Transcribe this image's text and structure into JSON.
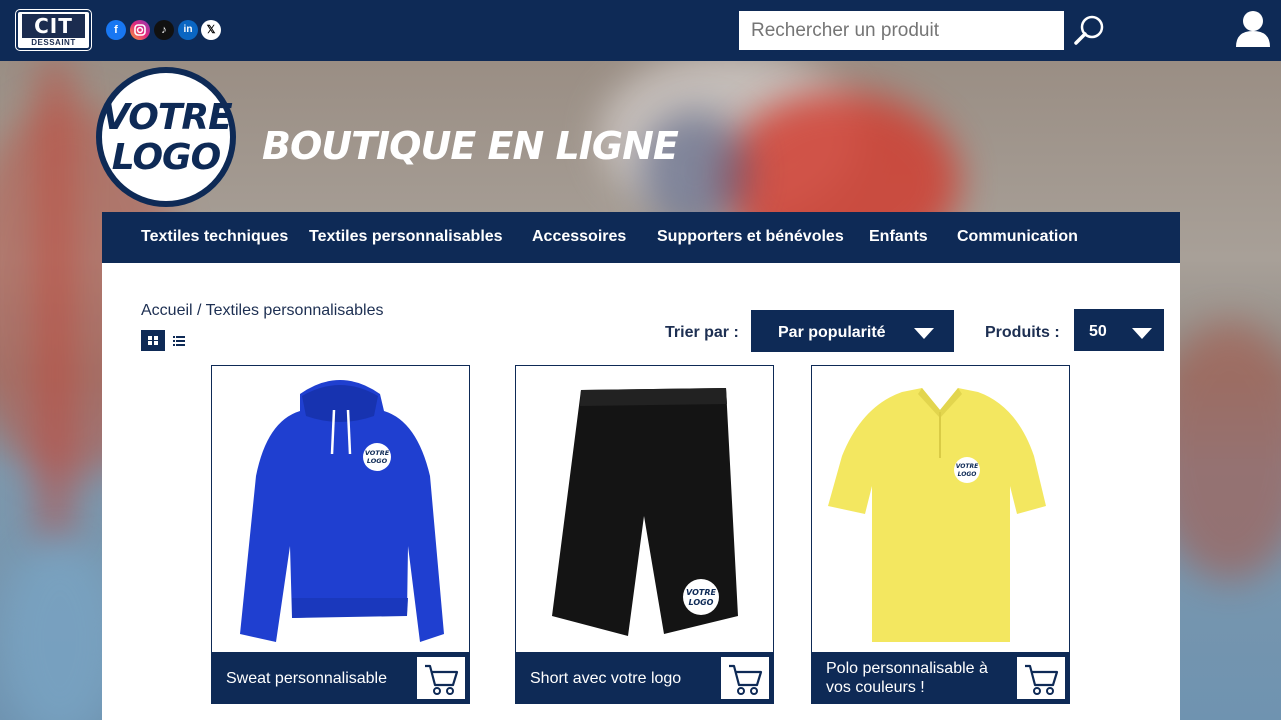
{
  "header": {
    "brand": {
      "mark": "CIT",
      "sub": "DESSAINT"
    },
    "social_icons": [
      "facebook-icon",
      "instagram-icon",
      "tiktok-icon",
      "linkedin-icon",
      "x-icon"
    ],
    "search_placeholder": "Rechercher un produit"
  },
  "hero": {
    "logo_line1": "VOTRE",
    "logo_line2": "LOGO",
    "title": "BOUTIQUE EN LIGNE"
  },
  "nav": {
    "items": [
      "Textiles techniques",
      "Textiles personnalisables",
      "Accessoires",
      "Supporters et bénévoles",
      "Enfants",
      "Communication"
    ]
  },
  "main": {
    "breadcrumb": "Accueil / Textiles personnalisables",
    "sort_label": "Trier par :",
    "sort_value": "Par popularité",
    "qty_label": "Produits :",
    "qty_value": "50"
  },
  "products": [
    {
      "name": "Sweat personnalisable",
      "color": "#1f3fd0"
    },
    {
      "name": "Short avec votre logo",
      "color": "#111111"
    },
    {
      "name": "Polo personnalisable à vos couleurs !",
      "color": "#f3e760"
    }
  ],
  "colors": {
    "navy": "#0e2a56"
  }
}
